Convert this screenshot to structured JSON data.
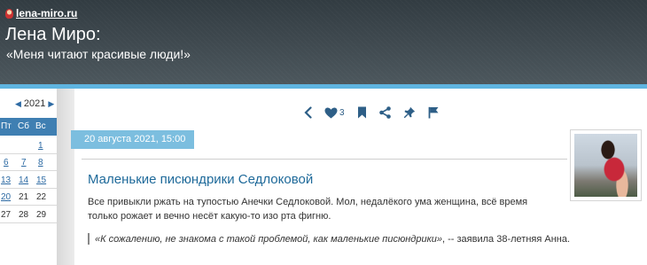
{
  "header": {
    "site_link": "lena-miro.ru",
    "title": "Лена Миро:",
    "subtitle": "«Меня читают красивые люди!»"
  },
  "calendar": {
    "year": "2021",
    "weekdays": [
      "Пт",
      "Сб",
      "Вс"
    ],
    "rows": [
      [
        "",
        "",
        "1"
      ],
      [
        "6",
        "7",
        "8"
      ],
      [
        "13",
        "14",
        "15"
      ],
      [
        "20",
        "21",
        "22"
      ],
      [
        "27",
        "28",
        "29"
      ]
    ]
  },
  "toolbar": {
    "like_count": "3",
    "icons": [
      "chevron-left-icon",
      "heart-icon",
      "bookmark-icon",
      "share-icon",
      "pin-icon",
      "flag-icon"
    ]
  },
  "post": {
    "date": "20 августа 2021, 15:00",
    "title": "Маленькие писюндрики Седлоковой",
    "text": "Все привыкли ржать на тупостью Анечки Седлоковой. Мол, недалёкого ума женщина, всё время только рожает и вечно несёт какую-то изо рта фигню.",
    "quote_italic": "«К сожалению, не знакома с такой проблемой, как маленькие писюндрики»",
    "quote_rest": ", -- заявила 38-летняя Анна."
  },
  "colors": {
    "accent": "#5eb4e0",
    "link": "#1f6a9a",
    "calendar_header": "#3f7fb2",
    "date_badge": "#7cbedf"
  }
}
